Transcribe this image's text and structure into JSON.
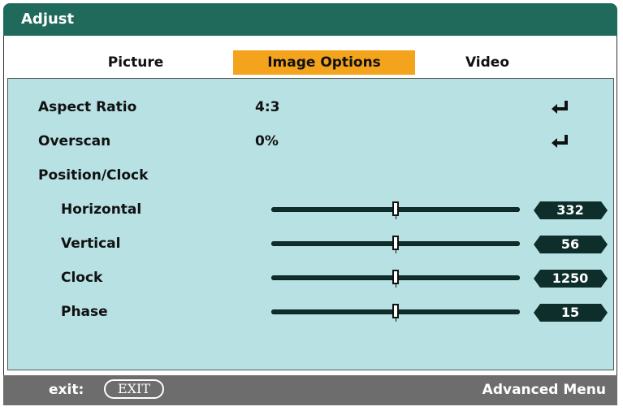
{
  "window": {
    "title": "Adjust"
  },
  "tabs": [
    {
      "label": "Picture",
      "active": false
    },
    {
      "label": "Image Options",
      "active": true
    },
    {
      "label": "Video",
      "active": false
    }
  ],
  "options": {
    "aspect_ratio": {
      "label": "Aspect Ratio",
      "value": "4:3"
    },
    "overscan": {
      "label": "Overscan",
      "value": "0%"
    },
    "position_clock": {
      "label": "Position/Clock"
    }
  },
  "sliders": [
    {
      "label": "Horizontal",
      "value": "332",
      "level": 0.5
    },
    {
      "label": "Vertical",
      "value": "56",
      "level": 0.5
    },
    {
      "label": "Clock",
      "value": "1250",
      "level": 0.5
    },
    {
      "label": "Phase",
      "value": "15",
      "level": 0.5
    }
  ],
  "footer": {
    "exit_label": "exit:",
    "exit_button": "EXIT",
    "advanced_menu": "Advanced Menu"
  },
  "colors": {
    "titlebar": "#1f6a5a",
    "active_tab": "#f4a31c",
    "panel": "#b8e1e4",
    "footer": "#6d6d6d",
    "value_box": "#0e2e2b"
  },
  "icons": [
    "enter-icon"
  ]
}
